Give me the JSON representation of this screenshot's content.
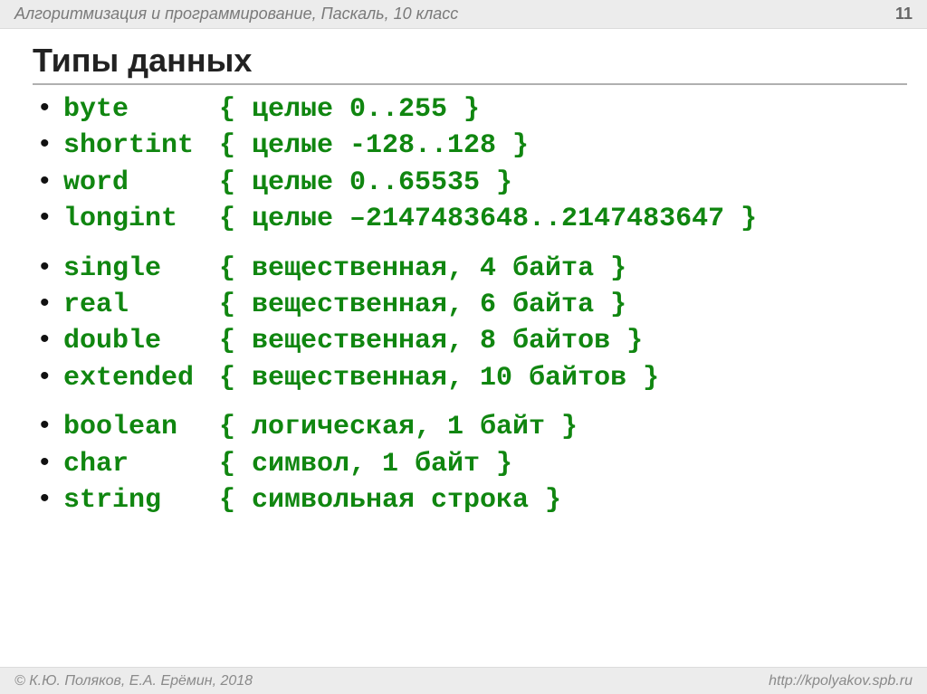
{
  "header": {
    "course": "Алгоритмизация и программирование, Паскаль, 10 класс",
    "page": "11"
  },
  "title": "Типы данных",
  "groups": [
    [
      {
        "name": "byte",
        "desc": "{ целые 0..255 }"
      },
      {
        "name": "shortint",
        "desc": "{ целые -128..128 }"
      },
      {
        "name": "word",
        "desc": "{ целые 0..65535 }"
      },
      {
        "name": "longint",
        "desc": "{ целые –2147483648..2147483647 }"
      }
    ],
    [
      {
        "name": "single",
        "desc": "{ вещественная, 4 байта }"
      },
      {
        "name": "real",
        "desc": "{ вещественная, 6 байта }"
      },
      {
        "name": "double",
        "desc": "{ вещественная, 8 байтов }"
      },
      {
        "name": "extended",
        "desc": "{ вещественная, 10 байтов }"
      }
    ],
    [
      {
        "name": "boolean",
        "desc": "{ логическая, 1 байт }"
      },
      {
        "name": "char",
        "desc": "{ символ, 1 байт }"
      },
      {
        "name": "string",
        "desc": "{ символьная строка }"
      }
    ]
  ],
  "footer": {
    "copyright": "© К.Ю. Поляков, Е.А. Ерёмин, 2018",
    "url": "http://kpolyakov.spb.ru"
  }
}
